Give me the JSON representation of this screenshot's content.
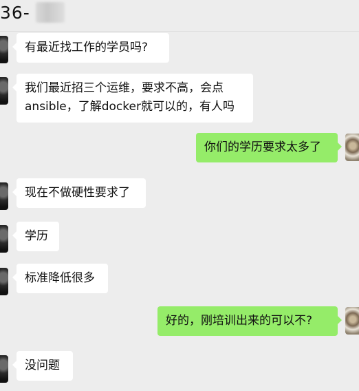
{
  "header": {
    "title": "36-"
  },
  "messages": [
    {
      "side": "in",
      "text": "有最近找工作的学员吗?"
    },
    {
      "side": "in",
      "text": "我们最近招三个运维，要求不高，会点\nansible，了解docker就可以的，有人吗"
    },
    {
      "side": "out",
      "text": "你们的学历要求太多了"
    },
    {
      "side": "in",
      "text": "现在不做硬性要求了"
    },
    {
      "side": "in",
      "text": "学历"
    },
    {
      "side": "in",
      "text": "标准降低很多"
    },
    {
      "side": "out",
      "text": "好的，刚培训出来的可以不?"
    },
    {
      "side": "in",
      "text": "没问题"
    }
  ]
}
